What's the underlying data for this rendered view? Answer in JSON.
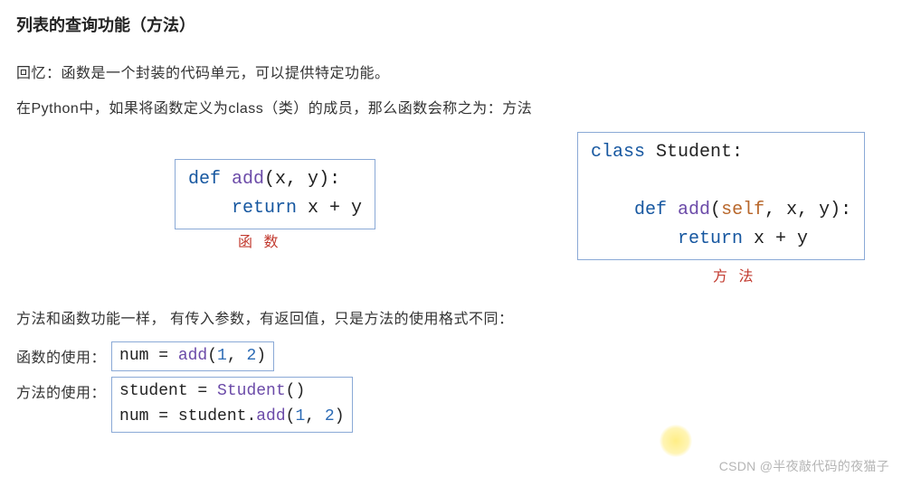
{
  "title": "列表的查询功能（方法）",
  "para1": "回忆：函数是一个封装的代码单元，可以提供特定功能。",
  "para2": "在Python中，如果将函数定义为class（类）的成员，那么函数会称之为：方法",
  "func_code": {
    "line1": {
      "kw": "def",
      "name": " add",
      "paren_open": "(",
      "args": "x, y",
      "paren_close": "):"
    },
    "line2": {
      "indent": "    ",
      "kw": "return",
      "expr": " x + y"
    }
  },
  "meth_code": {
    "line1": {
      "kw": "class",
      "name": " Student",
      "colon": ":"
    },
    "line3": {
      "indent": "    ",
      "kw": "def",
      "name": " add",
      "paren_open": "(",
      "self": "self",
      "rest": ", x, y",
      "paren_close": "):"
    },
    "line4": {
      "indent": "        ",
      "kw": "return",
      "expr": " x + y"
    }
  },
  "func_label": "函 数",
  "meth_label": "方 法",
  "para3": "方法和函数功能一样， 有传入参数，有返回值，只是方法的使用格式不同：",
  "usage_func_label": "函数的使用：",
  "usage_func_code": {
    "text1": "num = ",
    "fn": "add",
    "open": "(",
    "n1": "1",
    "comma": ", ",
    "n2": "2",
    "close": ")"
  },
  "usage_meth_label": "方法的使用：",
  "usage_meth_code": {
    "l1": {
      "text1": "student = ",
      "fn": "Student",
      "paren": "()"
    },
    "l2": {
      "text1": "num = student.",
      "fn": "add",
      "open": "(",
      "n1": "1",
      "comma": ", ",
      "n2": "2",
      "close": ")"
    }
  },
  "watermark": "CSDN @半夜敲代码的夜猫子"
}
